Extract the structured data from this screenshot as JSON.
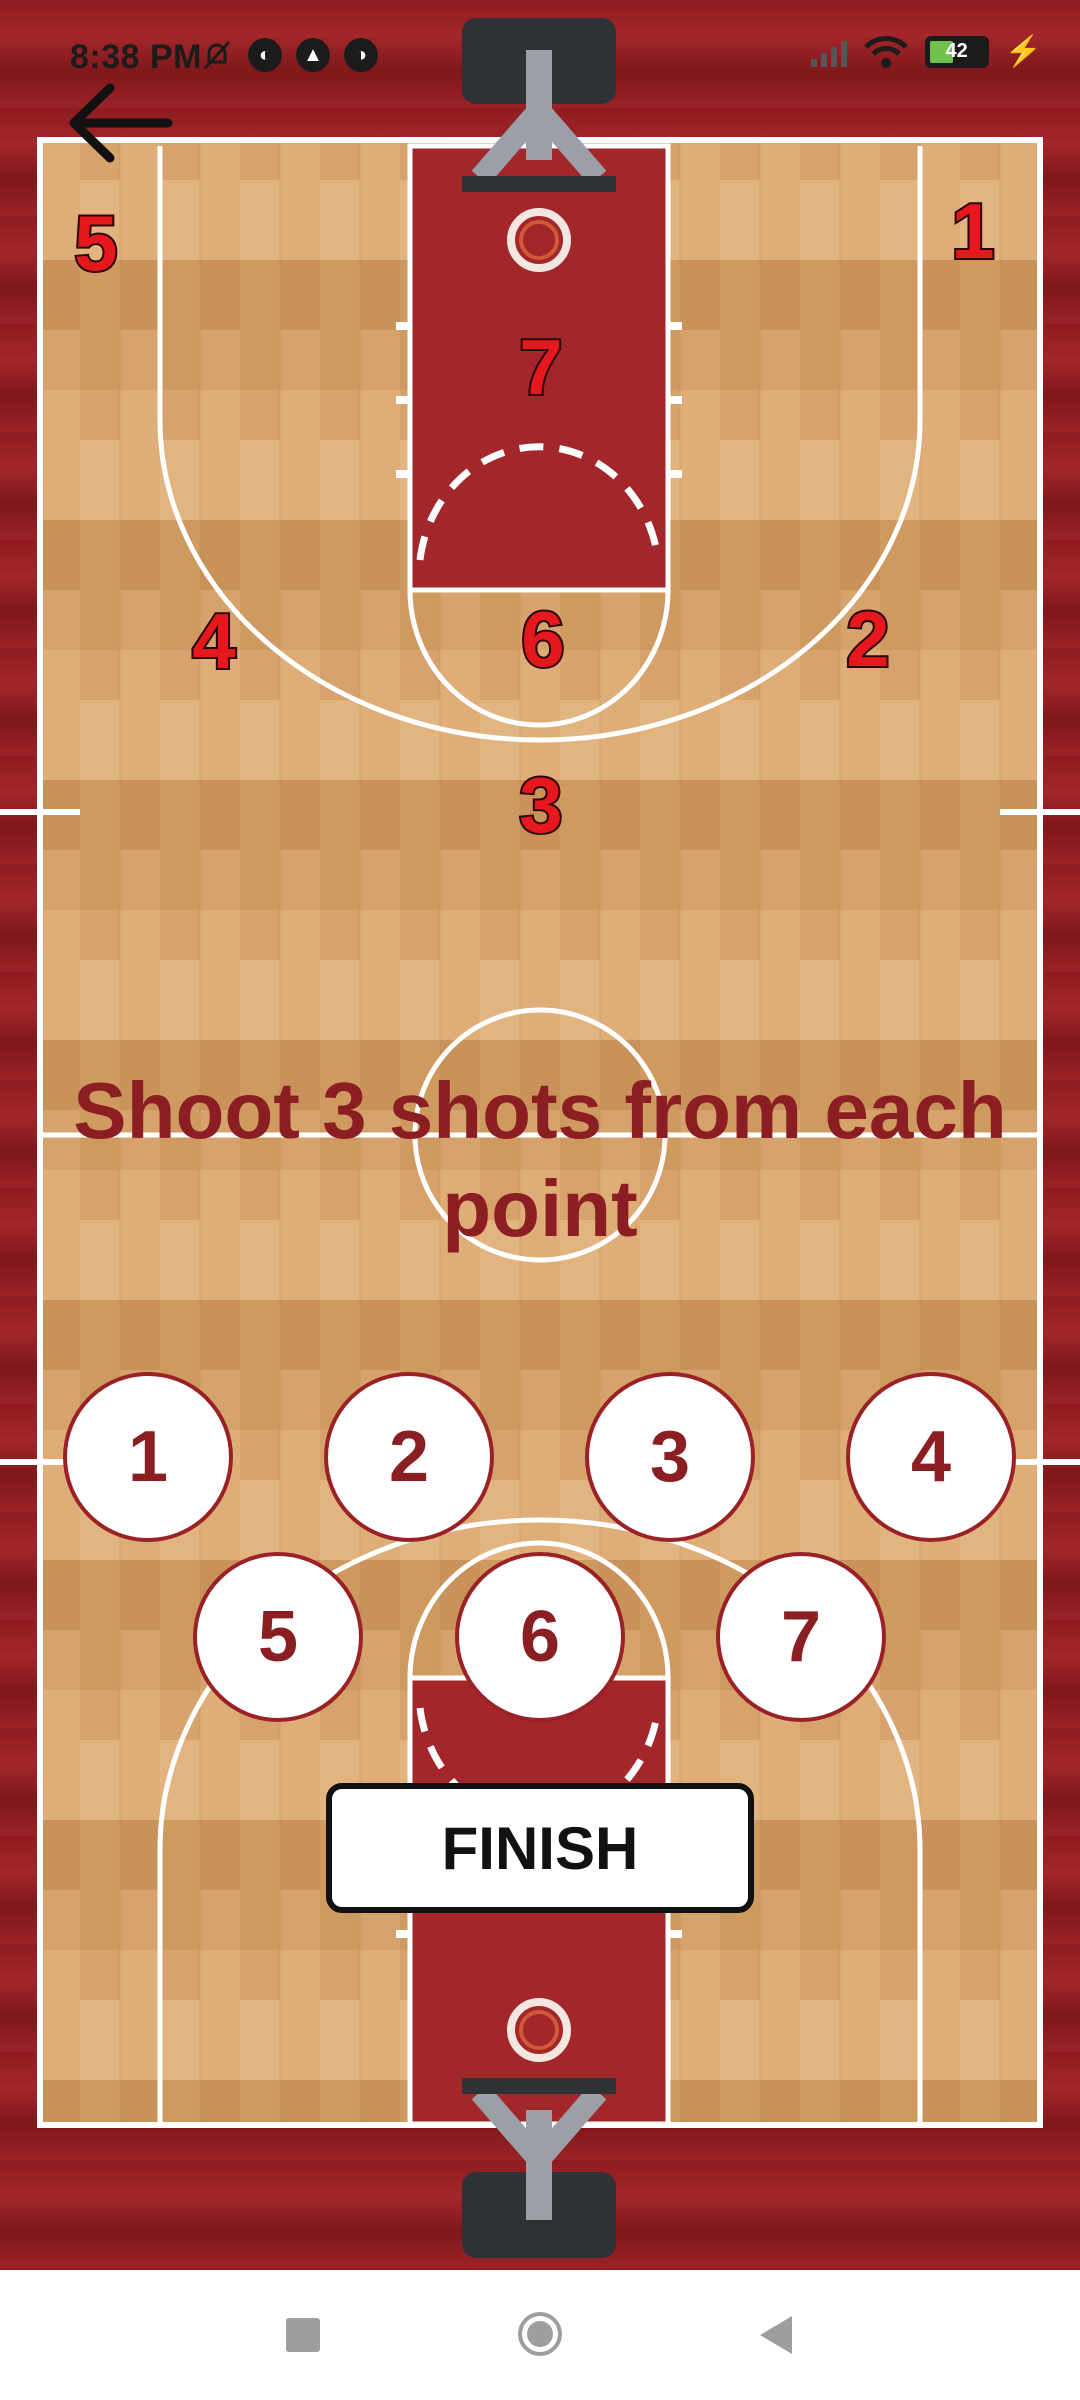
{
  "status_bar": {
    "time": "8:38 PM",
    "battery_level": "42",
    "icons": [
      "mute-bell-icon",
      "app-icon-1",
      "app-icon-2",
      "app-icon-3",
      "signal-icon",
      "wifi-icon",
      "battery-icon",
      "charging-bolt-icon"
    ]
  },
  "navigation": {
    "back_icon": "arrow-left-icon"
  },
  "court": {
    "spot_markers": [
      "1",
      "2",
      "3",
      "4",
      "5",
      "6",
      "7"
    ]
  },
  "instruction": "Shoot 3 shots from each point",
  "shot_spots": [
    "1",
    "2",
    "3",
    "4",
    "5",
    "6",
    "7"
  ],
  "finish_label": "FINISH",
  "system_nav": [
    "recents-icon",
    "home-icon",
    "back-icon"
  ],
  "colors": {
    "accent": "#8b1e22",
    "court_red": "#9a2226",
    "wood": "#d4a06b"
  }
}
